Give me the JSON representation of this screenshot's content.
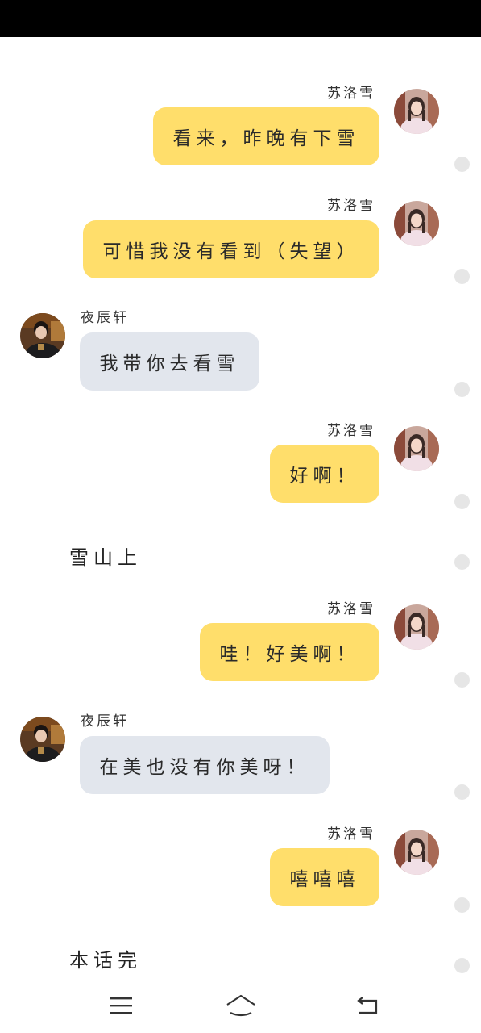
{
  "chat": {
    "sender_me": "苏洛雪",
    "sender_other": "夜辰轩",
    "messages": [
      {
        "text": "看来，昨晚有下雪"
      },
      {
        "text": "可惜我没有看到（失望）"
      },
      {
        "text": "我带你去看雪"
      },
      {
        "text": "好啊！"
      },
      {
        "text": "哇！好美啊！"
      },
      {
        "text": "在美也没有你美呀！"
      },
      {
        "text": "嘻嘻嘻"
      }
    ],
    "narrations": [
      "雪山上",
      "本话完"
    ]
  },
  "nav": {
    "icons": [
      "menu-icon",
      "home-icon",
      "back-icon"
    ]
  },
  "colors": {
    "my_bubble": "#ffde6b",
    "other_bubble": "#e2e6ed",
    "status_bar": "#000000"
  }
}
